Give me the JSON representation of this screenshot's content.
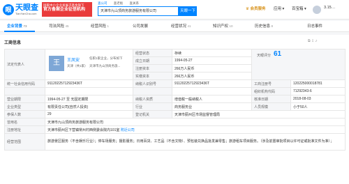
{
  "header": {
    "logo_main": "天眼查",
    "logo_sub": "TianYanCha.com",
    "banner_line1": "国家中小企业发展子基金旗下",
    "banner_line2": "官方备案企业征信机构",
    "search_tabs": [
      "查公司",
      "查老板",
      "查关系"
    ],
    "search_value": "天津市九山顶商务旅游服务有限公司",
    "search_button": "天眼一下",
    "vip_label": "会员服务",
    "menu_app": "应用",
    "menu_tools": "百宝箱",
    "user": "3.15…"
  },
  "nav": {
    "tabs": [
      {
        "label": "企业背景",
        "count": "73"
      },
      {
        "label": "司法风险",
        "count": "45"
      },
      {
        "label": "经营风险",
        "count": "1"
      },
      {
        "label": "公司发展",
        "count": ""
      },
      {
        "label": "经营状况",
        "count": "41"
      },
      {
        "label": "知识产权",
        "count": "10"
      },
      {
        "label": "历史信息",
        "count": "8"
      },
      {
        "label": "日志事件",
        "count": ""
      }
    ]
  },
  "card": {
    "title": "工商信息",
    "legal_label": "法定代表人",
    "legal_avatar": "王",
    "legal_name": "王凤安",
    "legal_role": "天津（共1家）",
    "legal_right": "任职1家企业，分布如下",
    "legal_company": "天津市九山顶商务旅...",
    "status_label": "经营状态",
    "status": "存续",
    "found_label": "成立日期",
    "found": "1994-05-27",
    "reg_cap_label": "注册资本",
    "reg_cap": "266万人民币",
    "paid_cap_label": "实缴资本",
    "paid_cap": "266万人民币",
    "score_label": "天眼评分",
    "score": "61",
    "reg_no_label": "工商注册号",
    "reg_no": "120225000018781",
    "credit_label": "统一社会信用代码",
    "credit": "91120225712923436T",
    "tax_label": "纳税人识别号",
    "tax": "91120225712923436T",
    "org_label": "组织机构代码",
    "org": "71292343-6",
    "term_label": "营业期限",
    "term": "1994-05-27 至 无固定期限",
    "taxpayer_label": "纳税人资质",
    "taxpayer": "增值税一般纳税人",
    "approve_label": "核准日期",
    "approve": "2018-08-03",
    "type_label": "企业类型",
    "type": "有限责任公司(自然人投资)",
    "industry_label": "行业",
    "industry": "商务服务业",
    "scale_label": "人员规模",
    "scale": "小于50人",
    "insured_label": "参保人数",
    "insured": "29",
    "authority_label": "登记机关",
    "authority": "天津市蓟州区市场监督管理局",
    "old_name_label": "曾用名",
    "old_name": "天津市九山顶商务旅游服务有限公司",
    "address_label": "注册地址",
    "address": "天津市蓟州区下营镇常州村西侧委会院内101室",
    "nearby": "附近公司",
    "scope_label": "经营范围",
    "scope": "旅游景区服务（不含娱乐行业）；停车场服务；摄影服务；日用百货、工艺品（不含文物）、预包装兑换品批发兼零售；旅游租车项目服务。（涉及前置审批项目以许可证或批准文件为准）；"
  }
}
